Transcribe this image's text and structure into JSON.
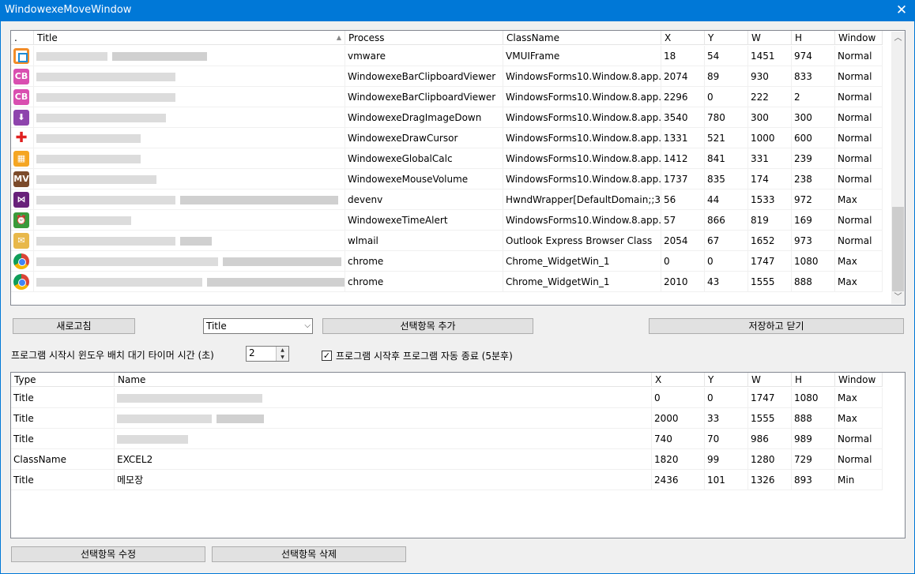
{
  "window": {
    "title": "WindowexeMoveWindow",
    "close_glyph": "✕"
  },
  "top_list": {
    "headers": [
      ".",
      "Title",
      "Process",
      "ClassName",
      "X",
      "Y",
      "W",
      "H",
      "Window"
    ],
    "sort_glyph": "▲",
    "rows": [
      {
        "icon": "vmware-icon",
        "icon_color": "#f28c28",
        "icon_text": "",
        "process": "vmware",
        "classname": "VMUIFrame",
        "x": "18",
        "y": "54",
        "w": "1451",
        "h": "974",
        "window": "Normal"
      },
      {
        "icon": "clipboard-viewer-icon",
        "icon_color": "#d94fb0",
        "icon_text": "CB",
        "process": "WindowexeBarClipboardViewer",
        "classname": "WindowsForms10.Window.8.app....",
        "x": "2074",
        "y": "89",
        "w": "930",
        "h": "833",
        "window": "Normal"
      },
      {
        "icon": "clipboard-viewer-icon",
        "icon_color": "#d94fb0",
        "icon_text": "CB",
        "process": "WindowexeBarClipboardViewer",
        "classname": "WindowsForms10.Window.8.app....",
        "x": "2296",
        "y": "0",
        "w": "222",
        "h": "2",
        "window": "Normal"
      },
      {
        "icon": "drag-image-down-icon",
        "icon_color": "#8e44ad",
        "icon_text": "⬇",
        "process": "WindowexeDragImageDown",
        "classname": "WindowsForms10.Window.8.app....",
        "x": "3540",
        "y": "780",
        "w": "300",
        "h": "300",
        "window": "Normal"
      },
      {
        "icon": "draw-cursor-icon",
        "icon_color": "#ffffff",
        "icon_text": "✚",
        "process": "WindowexeDrawCursor",
        "classname": "WindowsForms10.Window.8.app....",
        "x": "1331",
        "y": "521",
        "w": "1000",
        "h": "600",
        "window": "Normal"
      },
      {
        "icon": "global-calc-icon",
        "icon_color": "#f5a623",
        "icon_text": "▦",
        "process": "WindowexeGlobalCalc",
        "classname": "WindowsForms10.Window.8.app....",
        "x": "1412",
        "y": "841",
        "w": "331",
        "h": "239",
        "window": "Normal"
      },
      {
        "icon": "mouse-volume-icon",
        "icon_color": "#7b4a2a",
        "icon_text": "MV",
        "process": "WindowexeMouseVolume",
        "classname": "WindowsForms10.Window.8.app....",
        "x": "1737",
        "y": "835",
        "w": "174",
        "h": "238",
        "window": "Normal"
      },
      {
        "icon": "visual-studio-icon",
        "icon_color": "#68217a",
        "icon_text": "⋈",
        "process": "devenv",
        "classname": "HwndWrapper[DefaultDomain;;3,...",
        "x": "56",
        "y": "44",
        "w": "1533",
        "h": "972",
        "window": "Max"
      },
      {
        "icon": "time-alert-icon",
        "icon_color": "#3a9a3a",
        "icon_text": "⏰",
        "process": "WindowexeTimeAlert",
        "classname": "WindowsForms10.Window.8.app....",
        "x": "57",
        "y": "866",
        "w": "819",
        "h": "169",
        "window": "Normal"
      },
      {
        "icon": "windows-live-mail-icon",
        "icon_color": "#e8b84a",
        "icon_text": "✉",
        "process": "wlmail",
        "classname": "Outlook Express Browser Class",
        "x": "2054",
        "y": "67",
        "w": "1652",
        "h": "973",
        "window": "Normal"
      },
      {
        "icon": "chrome-icon",
        "icon_color": "#db4437",
        "icon_text": "",
        "process": "chrome",
        "classname": "Chrome_WidgetWin_1",
        "x": "0",
        "y": "0",
        "w": "1747",
        "h": "1080",
        "window": "Max"
      },
      {
        "icon": "chrome-icon",
        "icon_color": "#db4437",
        "icon_text": "",
        "process": "chrome",
        "classname": "Chrome_WidgetWin_1",
        "x": "2010",
        "y": "43",
        "w": "1555",
        "h": "888",
        "window": "Max"
      }
    ],
    "scroll_up_glyph": "︿",
    "scroll_down_glyph": "﹀"
  },
  "controls": {
    "refresh_label": "새로고침",
    "combo_value": "Title",
    "combo_arrow": "⌵",
    "add_selected_label": "선택항목 추가",
    "save_close_label": "저장하고 닫기",
    "timer_label": "프로그램 시작시 윈도우 배치 대기 타이머 시간 (초)",
    "timer_value": "2",
    "auto_close_label": "프로그램 시작후 프로그램 자동 종료 (5분후)",
    "auto_close_check": "✓"
  },
  "bottom_list": {
    "headers": [
      "Type",
      "Name",
      "X",
      "Y",
      "W",
      "H",
      "Window"
    ],
    "rows": [
      {
        "type": "Title",
        "name": "",
        "blurred": true,
        "x": "0",
        "y": "0",
        "w": "1747",
        "h": "1080",
        "window": "Max"
      },
      {
        "type": "Title",
        "name": "",
        "blurred": true,
        "x": "2000",
        "y": "33",
        "w": "1555",
        "h": "888",
        "window": "Max"
      },
      {
        "type": "Title",
        "name": "",
        "blurred": true,
        "x": "740",
        "y": "70",
        "w": "986",
        "h": "989",
        "window": "Normal"
      },
      {
        "type": "ClassName",
        "name": "EXCEL2",
        "blurred": false,
        "x": "1820",
        "y": "99",
        "w": "1280",
        "h": "729",
        "window": "Normal"
      },
      {
        "type": "Title",
        "name": "메모장",
        "blurred": false,
        "x": "2436",
        "y": "101",
        "w": "1326",
        "h": "893",
        "window": "Min"
      }
    ]
  },
  "footer": {
    "edit_selected_label": "선택항목 수정",
    "delete_selected_label": "선택항목 삭제"
  }
}
